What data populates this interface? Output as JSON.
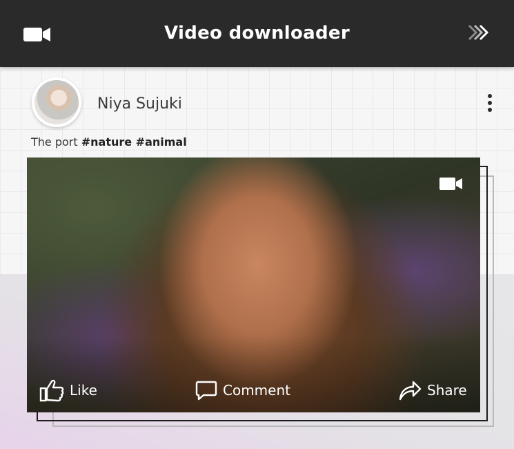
{
  "header": {
    "title": "Video downloader",
    "left_icon": "video-camera-icon",
    "right_icon": "double-chevron-right-icon"
  },
  "post": {
    "username": "Niya Sujuki",
    "caption_text": "The port ",
    "caption_tags": "#nature #animal",
    "menu_icon": "more-vertical-icon",
    "media_icon": "video-camera-icon",
    "actions": {
      "like": "Like",
      "comment": "Comment",
      "share": "Share"
    }
  },
  "colors": {
    "header_bg": "#2a2a2a",
    "header_text": "#ffffff",
    "accent_dark": "#1d1d1d"
  }
}
